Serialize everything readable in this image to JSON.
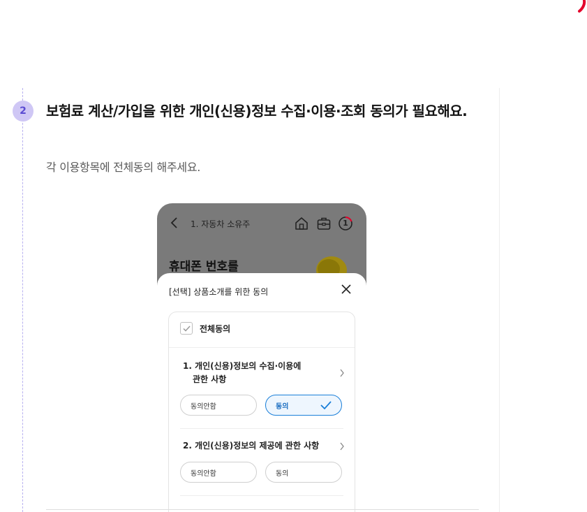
{
  "step": {
    "number": "2",
    "title": "보험료 계산/가입을 위한 개인(신용)정보 수집·이용·조회 동의가 필요해요.",
    "description": "각 이용항목에 전체동의 해주세요."
  },
  "phone": {
    "header_title": "1. 자동차 소유주",
    "badge_number": "1",
    "background_title": "휴대폰 번호를",
    "sheet": {
      "title": "[선택] 상품소개를 위한 동의",
      "all_agree_label": "전체동의",
      "items": [
        {
          "title_line1": "1. 개인(신용)정보의 수집·이용에",
          "title_line2": "관한 사항",
          "decline_label": "동의안함",
          "agree_label": "동의",
          "agreed": true
        },
        {
          "title_line1": "2. 개인(신용)정보의 제공에 관한 사항",
          "title_line2": "",
          "decline_label": "동의안함",
          "agree_label": "동의",
          "agreed": false
        }
      ]
    }
  },
  "colors": {
    "accent": "#1a7fd9",
    "step_badge": "#cfc7f5",
    "brand_red": "#e4002b"
  }
}
